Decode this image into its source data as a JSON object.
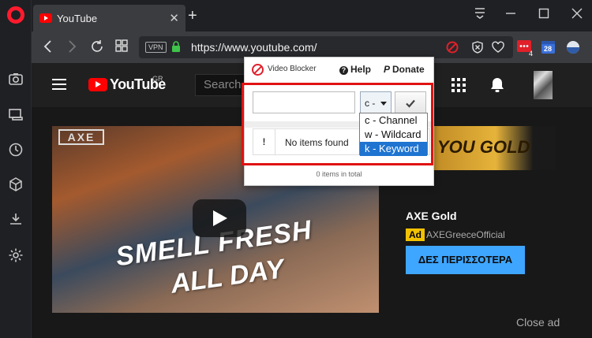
{
  "browser": {
    "tab_title": "YouTube",
    "tab_close": "✕",
    "new_tab": "+",
    "url": "https://www.youtube.com/",
    "vpn_badge": "VPN",
    "ext_badge_count": "4",
    "calendar_day": "28"
  },
  "sidebar": {
    "items": [
      "camera-icon",
      "snapshot-icon",
      "history-icon",
      "extensions-icon",
      "downloads-icon",
      "settings-icon"
    ]
  },
  "youtube": {
    "logo": "YouTube",
    "country": "GR",
    "search_placeholder": "Search",
    "video": {
      "brand": "AXE",
      "line1": "SMELL FRESH",
      "line2": "ALL DAY"
    },
    "ad": {
      "banner_text": "YOU GOLD",
      "title": "AXE Gold",
      "badge": "Ad",
      "channel": "AXEGreeceOfficial",
      "cta": "ΔΕΣ ΠΕΡΙΣΣΟΤΕΡΑ",
      "close": "Close ad"
    }
  },
  "popup": {
    "title": "Video Blocker",
    "help": "Help",
    "donate": "Donate",
    "input_value": "",
    "selected_type": "c -",
    "options": [
      "c - Channel",
      "w - Wildcard",
      "k - Keyword"
    ],
    "highlighted_option_index": 2,
    "table_marker": "!",
    "empty_message": "No items found",
    "total": "0 items in total"
  },
  "colors": {
    "opera_red": "#ff1b2d",
    "youtube_red": "#ff0000",
    "highlight_box": "#e01212",
    "cta_blue": "#3ea6ff",
    "option_highlight": "#1e74d0"
  }
}
